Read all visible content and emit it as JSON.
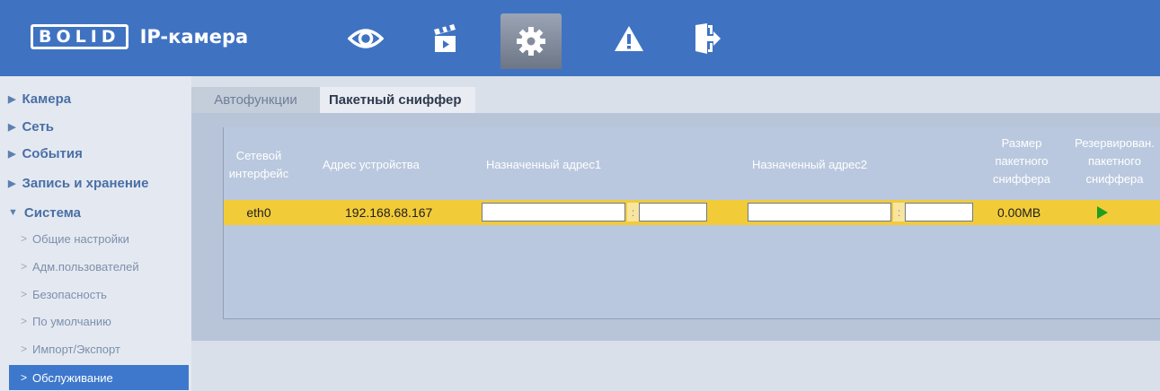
{
  "header": {
    "logo_brand": "BOLID",
    "logo_product": "IP-камера",
    "nav_icons": [
      "eye-icon",
      "clapperboard-icon",
      "gear-icon",
      "warning-icon",
      "exit-door-icon"
    ],
    "active_nav": "gear-icon"
  },
  "sidebar": {
    "sections": [
      {
        "label": "Камера",
        "expanded": false
      },
      {
        "label": "Сеть",
        "expanded": false
      },
      {
        "label": "События",
        "expanded": false
      },
      {
        "label": "Запись и хранение",
        "expanded": false
      },
      {
        "label": "Система",
        "expanded": true
      }
    ],
    "system_items": [
      {
        "label": "Общие настройки"
      },
      {
        "label": "Адм.пользователей"
      },
      {
        "label": "Безопасность"
      },
      {
        "label": "По умолчанию"
      },
      {
        "label": "Импорт/Экспорт"
      },
      {
        "label": "Обслуживание",
        "active": true
      }
    ]
  },
  "tabs": [
    {
      "label": "Автофункции",
      "active": false
    },
    {
      "label": "Пакетный сниффер",
      "active": true
    }
  ],
  "table": {
    "headers": {
      "iface_1": "Сетевой",
      "iface_2": "интерфейс",
      "device_addr": "Адрес устройства",
      "dest_addr1": "Назначенный адрес1",
      "dest_addr2": "Назначенный адрес2",
      "size_1": "Размер",
      "size_2": "пакетного",
      "size_3": "сниффера",
      "backup_1": "Резервирован.",
      "backup_2": "пакетного",
      "backup_3": "сниффера"
    },
    "row": {
      "interface": "eth0",
      "device_address": "192.168.68.167",
      "dest1_ip": "",
      "dest1_port": "",
      "dest2_ip": "",
      "dest2_port": "",
      "colon": ":",
      "size": "0.00MB"
    }
  },
  "colors": {
    "header_bg": "#3f73c2",
    "row_highlight": "#f2cb39",
    "active_menu": "#3d78cc",
    "play_icon": "#1ea01e"
  }
}
